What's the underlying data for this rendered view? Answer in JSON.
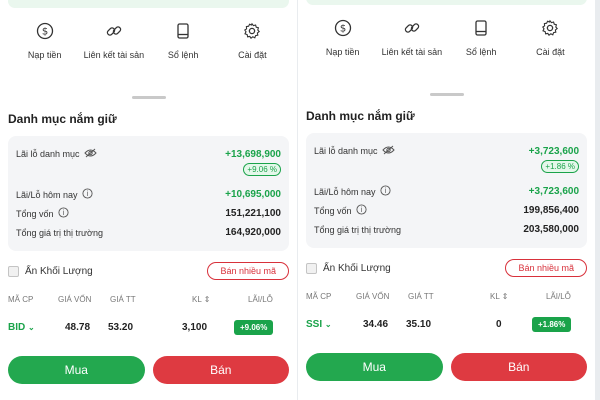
{
  "colors": {
    "green": "#1aa34a",
    "red": "#d8313b",
    "card_bg": "#f4f5f7"
  },
  "actions": [
    {
      "label": "Nạp tiền",
      "icon": "dollar-coin-icon"
    },
    {
      "label": "Liên kết tài sản",
      "icon": "link-icon"
    },
    {
      "label": "Sổ lệnh",
      "icon": "book-icon"
    },
    {
      "label": "Cài đặt",
      "icon": "gear-icon"
    }
  ],
  "left": {
    "section_title": "Danh mục nắm giữ",
    "pl_portfolio_label": "Lãi lỗ danh mục",
    "pl_portfolio_value": "+13,698,900",
    "pl_portfolio_pct": "+9.06 %",
    "pl_today_label": "Lãi/Lỗ hôm nay",
    "pl_today_value": "+10,695,000",
    "capital_label": "Tổng vốn",
    "capital_value": "151,221,100",
    "market_value_label": "Tổng giá trị thị trường",
    "market_value_value": "164,920,000",
    "hide_volume_label": "Ẩn Khối Lượng",
    "sell_many_label": "Bán nhiều mã",
    "table_headers": {
      "symbol": "MÃ CP",
      "cost": "GIÁ VỐN",
      "price": "GIÁ TT",
      "qty": "KL ⇕",
      "pl": "LÃI/LỖ"
    },
    "holding": {
      "symbol": "BID",
      "cost": "48.78",
      "price": "53.20",
      "qty": "3,100",
      "pl": "+9.06%"
    },
    "buy_label": "Mua",
    "sell_label": "Bán"
  },
  "right": {
    "section_title": "Danh mục nắm giữ",
    "pl_portfolio_label": "Lãi lỗ danh mục",
    "pl_portfolio_value": "+3,723,600",
    "pl_portfolio_pct": "+1.86 %",
    "pl_today_label": "Lãi/Lỗ hôm nay",
    "pl_today_value": "+3,723,600",
    "capital_label": "Tổng vốn",
    "capital_value": "199,856,400",
    "market_value_label": "Tổng giá trị thị trường",
    "market_value_value": "203,580,000",
    "hide_volume_label": "Ẩn Khối Lượng",
    "sell_many_label": "Bán nhiều mã",
    "table_headers": {
      "symbol": "MÃ CP",
      "cost": "GIÁ VỐN",
      "price": "GIÁ TT",
      "qty": "KL ⇕",
      "pl": "LÃI/LỖ"
    },
    "holding": {
      "symbol": "SSI",
      "cost": "34.46",
      "price": "35.10",
      "qty": "0",
      "pl": "+1.86%"
    },
    "buy_label": "Mua",
    "sell_label": "Bán"
  }
}
